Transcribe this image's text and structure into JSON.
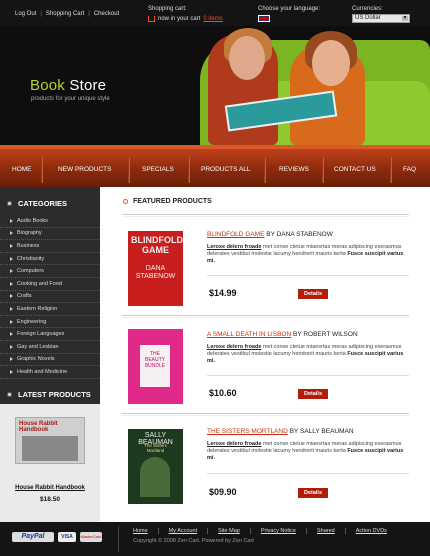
{
  "header": {
    "links": [
      "Log Out",
      "Shopping Cart",
      "Checkout"
    ],
    "cart_label": "Shopping cart:",
    "cart_text": "now in your cart",
    "cart_items": "0 items",
    "language_label": "Choose your language:",
    "currency_label": "Currencies:",
    "currency_value": "US Dollar"
  },
  "hero": {
    "brand_part1": "Book",
    "brand_part2": "Store",
    "tagline": "products for your unique style"
  },
  "nav": [
    "HOME",
    "NEW PRODUCTS",
    "SPECIALS",
    "PRODUCTS ALL",
    "REVIEWS",
    "CONTACT US",
    "FAQ"
  ],
  "sidebar": {
    "categories_title": "CATEGORIES",
    "categories": [
      "Audio Books",
      "Biography",
      "Business",
      "Christianity",
      "Computers",
      "Cooking and Food",
      "Crafts",
      "Eastern Religion",
      "Engineering",
      "Foreign Languages",
      "Gay and Lesbian",
      "Graphic Novels",
      "Health and Medicine"
    ],
    "latest_title": "LATEST PRODUCTS",
    "latest_cover_title": "House Rabbit Handbook",
    "latest_name": "House Rabbit Handbook",
    "latest_price": "$18.50"
  },
  "main": {
    "title": "FEATURED PRODUCTS",
    "products": [
      {
        "name": "BLINDFOLD GAME",
        "by": "BY DANA STABENOW",
        "lead": "Lerose delero froade",
        "desc": "met conse ctetue miaesrtas meras adipiscing eserasmus delerates vestibul molestie lacumy hendrerit mauris kerta",
        "bold": "Fusce suscipit varius mi.",
        "price": "$14.99",
        "details": "Details",
        "cover_title": "BLINDFOLD GAME",
        "cover_author": "DANA STABENOW"
      },
      {
        "name": "A SMALL DEATH IN LISBON",
        "by": "BY ROBERT WILSON",
        "lead": "Lerose delero froade",
        "desc": "met conse ctetue miaesrtas meras adipiscing eserasmus delerates vestibul molestie lacumy hendrerit mauris kerta",
        "bold": "Fusce suscipit varius mi.",
        "price": "$10.60",
        "details": "Details",
        "cover_title": "THE BEAUTY BUNDLE"
      },
      {
        "name": "THE SISTERS MORTLAND",
        "by": "BY SALLY BEAUMAN",
        "lead": "Lerose delero froade",
        "desc": "met conse ctetue miaesrtas meras adipiscing eserasmus delerates vestibul molestie lacumy hendrerit mauris kerta",
        "bold": "Fusce suscipit varius mi.",
        "price": "$09.90",
        "details": "Details",
        "cover_title": "SALLY BEAUMAN",
        "cover_sub": "The Sisters Mortland"
      }
    ]
  },
  "footer": {
    "payments": [
      "PayPal",
      "VISA",
      "MasterCard"
    ],
    "links": [
      "Home",
      "My Account",
      "Site Map",
      "Privacy Notice",
      "Shared",
      "Action DVDs"
    ],
    "copyright": "Copyright © 2008 Zen Cart. Powered by Zen Cart"
  },
  "colors": {
    "accent": "#c83010",
    "nav": "#a0361a",
    "sidebar": "#2c2c2c",
    "brand_green": "#b8cf2c"
  }
}
